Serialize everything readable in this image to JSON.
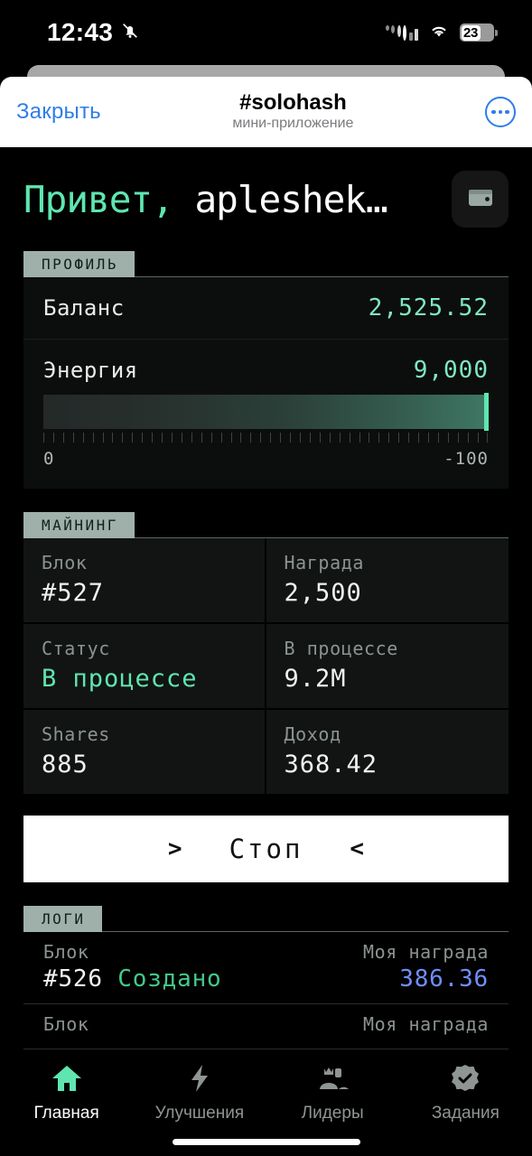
{
  "status_bar": {
    "time": "12:43",
    "mute_icon": "bell-slash-icon",
    "signal_icon": "cellular-signal-icon",
    "wifi_icon": "wifi-icon",
    "battery_level": "23"
  },
  "mini_app_header": {
    "close_label": "Закрыть",
    "title": "#solohash",
    "subtitle": "мини-приложение",
    "more_icon": "more-options-icon"
  },
  "greeting": {
    "hi": "Привет,",
    "username": " apleshek…",
    "wallet_icon": "wallet-icon"
  },
  "profile": {
    "tab_label": "ПРОФИЛЬ",
    "balance": {
      "label": "Баланс",
      "value": "2,525.52"
    },
    "energy": {
      "label": "Энергия",
      "value": "9,000",
      "scale_min": "0",
      "scale_max": "-100",
      "fill_percent": 100
    }
  },
  "mining": {
    "tab_label": "МАЙНИНГ",
    "cells": [
      {
        "label": "Блок",
        "value": "#527",
        "mint": false
      },
      {
        "label": "Награда",
        "value": "2,500",
        "mint": false
      },
      {
        "label": "Статус",
        "value": "В процессе",
        "mint": true
      },
      {
        "label": "В процессе",
        "value": "9.2M",
        "mint": false
      },
      {
        "label": "Shares",
        "value": "885",
        "mint": false
      },
      {
        "label": "Доход",
        "value": "368.42",
        "mint": false
      }
    ]
  },
  "action": {
    "left_arrow": ">",
    "label": "Стоп",
    "right_arrow": "<"
  },
  "logs": {
    "tab_label": "ЛОГИ",
    "rows": [
      {
        "block_label": "Блок",
        "reward_label": "Моя награда",
        "block_value": "#526",
        "block_status": "Создано",
        "reward_value": "386.36"
      },
      {
        "block_label": "Блок",
        "reward_label": "Моя награда",
        "block_value": "",
        "block_status": "",
        "reward_value": ""
      }
    ]
  },
  "bottom_nav": {
    "items": [
      {
        "label": "Главная",
        "icon": "home-icon",
        "active": true
      },
      {
        "label": "Улучшения",
        "icon": "bolt-icon",
        "active": false
      },
      {
        "label": "Лидеры",
        "icon": "leaders-icon",
        "active": false
      },
      {
        "label": "Задания",
        "icon": "tasks-icon",
        "active": false
      }
    ]
  },
  "colors": {
    "accent_mint": "#5fe6b0",
    "accent_blue": "#6f8ffb",
    "link_blue": "#2f7dea",
    "tab_gray": "#9fb0aa"
  }
}
